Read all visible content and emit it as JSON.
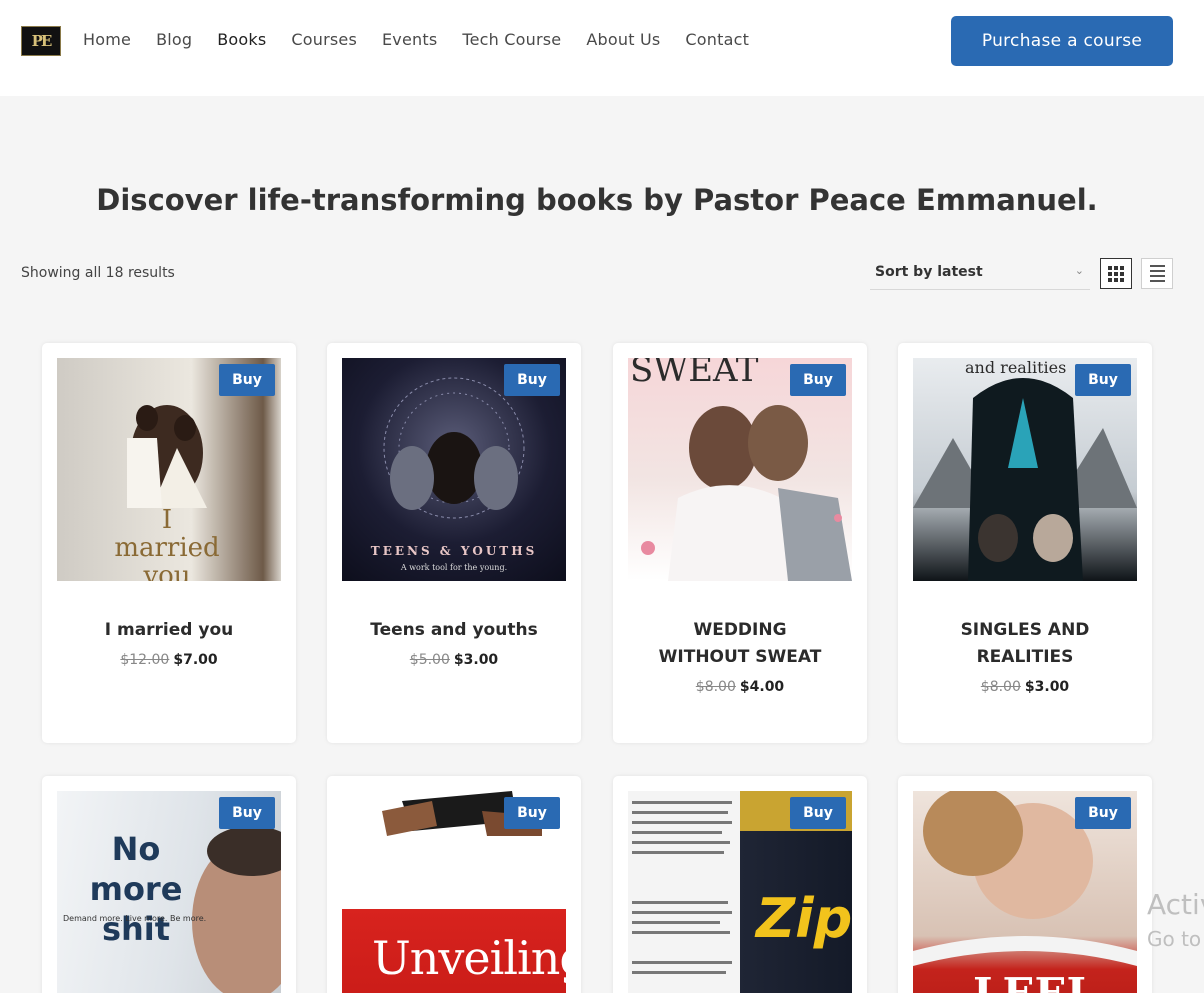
{
  "header": {
    "logo_icon": "brand-logo-icon",
    "logo_monogram": "PE",
    "nav": [
      "Home",
      "Blog",
      "Books",
      "Courses",
      "Events",
      "Tech Course",
      "About Us",
      "Contact"
    ],
    "active_nav": "Books",
    "cta_label": "Purchase a course"
  },
  "page": {
    "title": "Discover life-transforming books by Pastor Peace Emmanuel.",
    "results_text": "Showing all 18 results",
    "sort_label": "Sort by latest",
    "view_grid_icon": "grid-view-icon",
    "view_list_icon": "list-view-icon"
  },
  "products": [
    {
      "title_lines": [
        "I married you"
      ],
      "old_price": "$12.00",
      "new_price": "$7.00",
      "buy": "Buy",
      "cover_text": "I married you"
    },
    {
      "title_lines": [
        "Teens and youths"
      ],
      "old_price": "$5.00",
      "new_price": "$3.00",
      "buy": "Buy",
      "cover_text": "TEENS & YOUTHS",
      "cover_sub": "A work tool for the young."
    },
    {
      "title_lines": [
        "WEDDING",
        "WITHOUT SWEAT"
      ],
      "old_price": "$8.00",
      "new_price": "$4.00",
      "buy": "Buy",
      "cover_text": "SWEAT"
    },
    {
      "title_lines": [
        "SINGLES AND",
        "REALITIES"
      ],
      "old_price": "$8.00",
      "new_price": "$3.00",
      "buy": "Buy",
      "cover_text": "and realities"
    },
    {
      "buy": "Buy",
      "cover_text": "No more shit",
      "cover_sub": "Demand more. Live more. Be more."
    },
    {
      "buy": "Buy",
      "cover_text": "Unveiling"
    },
    {
      "buy": "Buy",
      "cover_text": "Zip"
    },
    {
      "buy": "Buy",
      "cover_text": "LEEL"
    }
  ],
  "watermark": {
    "line1": "Activ",
    "line2": "Go to"
  },
  "colors": {
    "accent": "#2a6ab3",
    "background": "#f5f5f5"
  }
}
